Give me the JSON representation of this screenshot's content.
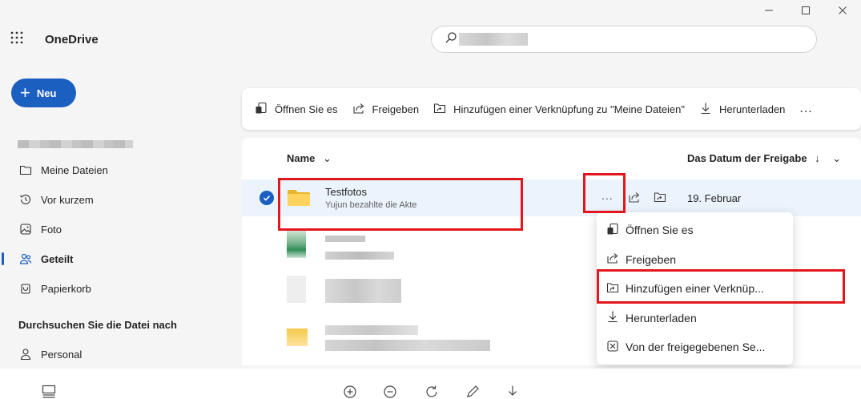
{
  "window": {
    "minimize_icon": "minimize-icon",
    "maximize_icon": "maximize-icon",
    "close_icon": "close-icon"
  },
  "header": {
    "app_title": "OneDrive",
    "search_placeholder": ""
  },
  "sidebar": {
    "new_label": "Neu",
    "items": [
      {
        "label": "Meine Dateien",
        "icon": "folder-icon"
      },
      {
        "label": "Vor kurzem",
        "icon": "history-icon"
      },
      {
        "label": "Foto",
        "icon": "photo-icon"
      },
      {
        "label": "Geteilt",
        "icon": "people-icon",
        "active": true
      },
      {
        "label": "Papierkorb",
        "icon": "trash-icon"
      }
    ],
    "browse_heading": "Durchsuchen Sie die Datei nach",
    "browse_items": [
      {
        "label": "Personal",
        "icon": "person-icon"
      }
    ]
  },
  "commandbar": {
    "open": "Öffnen Sie es",
    "share": "Freigeben",
    "add_shortcut": "Hinzufügen einer Verknüpfung zu \"Meine Dateien\"",
    "download": "Herunterladen",
    "more": "..."
  },
  "list": {
    "col_name": "Name",
    "col_date": "Das Datum der Freigabe",
    "rows": [
      {
        "title": "Testfotos",
        "subtitle": "Yujun bezahlte die Akte",
        "date": "19. Februar",
        "more": "..."
      }
    ]
  },
  "context_menu": {
    "items": [
      {
        "label": "Öffnen Sie es",
        "icon": "open-icon"
      },
      {
        "label": "Freigeben",
        "icon": "share-icon"
      },
      {
        "label": "Hinzufügen einer Verknüp...",
        "icon": "add-shortcut-icon"
      },
      {
        "label": "Herunterladen",
        "icon": "download-icon"
      },
      {
        "label": "Von der freigegebenen Se...",
        "icon": "remove-icon"
      }
    ]
  },
  "colors": {
    "accent": "#1b5fc1",
    "highlight": "#e3161d",
    "selected_row": "#ebf3fc",
    "folder": "#ffd35c"
  }
}
